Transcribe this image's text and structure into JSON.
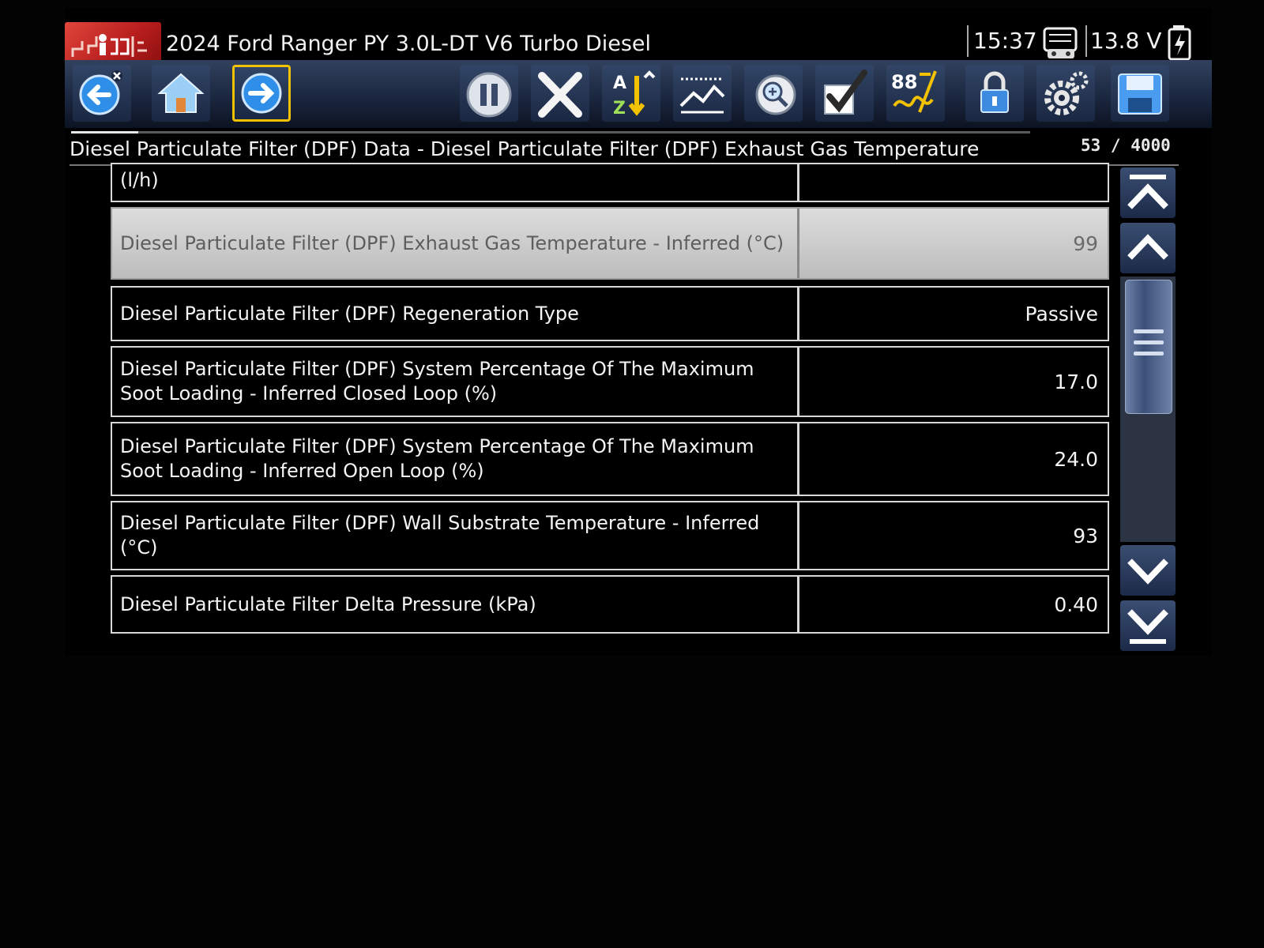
{
  "header": {
    "vehicle_title": "2024 Ford Ranger PY 3.0L-DT V6 Turbo Diesel",
    "time": "15:37",
    "voltage": "13.8 V"
  },
  "toolbar": {
    "buttons": [
      {
        "name": "back-button",
        "icon": "back-arrow-icon"
      },
      {
        "name": "home-button",
        "icon": "home-icon"
      },
      {
        "name": "forward-button",
        "icon": "forward-arrow-icon",
        "selected": true
      },
      {
        "name": "pause-button",
        "icon": "pause-icon"
      },
      {
        "name": "clear-button",
        "icon": "close-icon"
      },
      {
        "name": "sort-button",
        "icon": "sort-az-icon"
      },
      {
        "name": "graph-button",
        "icon": "graph-icon"
      },
      {
        "name": "zoom-button",
        "icon": "zoom-icon"
      },
      {
        "name": "select-button",
        "icon": "checkmark-icon"
      },
      {
        "name": "pid-trigger-button",
        "icon": "pid-trigger-icon",
        "label": "88"
      },
      {
        "name": "lock-button",
        "icon": "lock-icon"
      },
      {
        "name": "settings-button",
        "icon": "gear-icon"
      },
      {
        "name": "save-button",
        "icon": "save-icon"
      }
    ]
  },
  "breadcrumb": "Diesel Particulate Filter (DPF) Data - Diesel Particulate Filter (DPF) Exhaust Gas Temperature",
  "counter": "53 / 4000",
  "progress": 0.013,
  "rows": [
    {
      "name": "(l/h)",
      "value": ""
    },
    {
      "name": "Diesel Particulate Filter (DPF) Exhaust Gas Temperature - Inferred (°C)",
      "value": "99",
      "highlight": true
    },
    {
      "name": "Diesel Particulate Filter (DPF) Regeneration Type",
      "value": "Passive"
    },
    {
      "name": "Diesel Particulate Filter (DPF) System Percentage Of The Maximum Soot Loading - Inferred Closed Loop (%)",
      "value": "17.0"
    },
    {
      "name": "Diesel Particulate Filter (DPF) System Percentage Of The Maximum Soot Loading - Inferred Open Loop (%)",
      "value": "24.0"
    },
    {
      "name": "Diesel Particulate Filter (DPF) Wall Substrate Temperature - Inferred (°C)",
      "value": "93"
    },
    {
      "name": "Diesel Particulate Filter Delta Pressure (kPa)",
      "value": "0.40"
    }
  ],
  "colors": {
    "toolbar_bg": "#1b2740",
    "selected_border": "#f2c200",
    "highlight_row": "#c8c8c8"
  }
}
